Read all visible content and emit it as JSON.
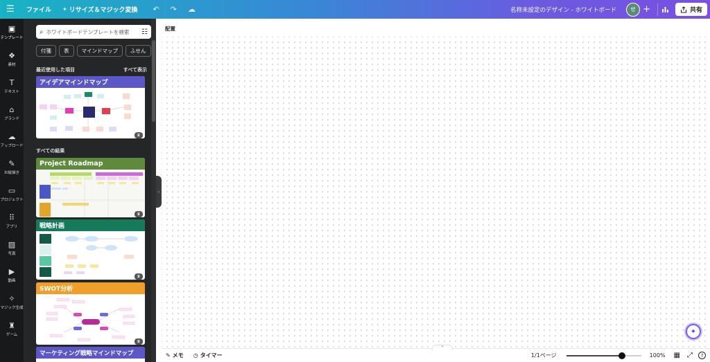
{
  "topbar": {
    "file": "ファイル",
    "resize": "リサイズ＆マジック変換",
    "title": "名称未設定のデザイン - ホワイトボード",
    "avatar_initial": "せ",
    "share": "共有"
  },
  "rail": [
    {
      "label": "テンプレート",
      "icon": "template-icon"
    },
    {
      "label": "素材",
      "icon": "elements-icon"
    },
    {
      "label": "テキスト",
      "icon": "text-icon"
    },
    {
      "label": "ブランド",
      "icon": "brand-icon"
    },
    {
      "label": "アップロード",
      "icon": "upload-icon"
    },
    {
      "label": "お絵描き",
      "icon": "draw-icon"
    },
    {
      "label": "プロジェクト",
      "icon": "folder-icon"
    },
    {
      "label": "アプリ",
      "icon": "apps-icon"
    },
    {
      "label": "写真",
      "icon": "photo-icon"
    },
    {
      "label": "動画",
      "icon": "video-icon"
    },
    {
      "label": "マジック生成",
      "icon": "magic-generate-icon"
    },
    {
      "label": "ゲーム",
      "icon": "game-icon"
    }
  ],
  "panel": {
    "search_placeholder": "ホワイトボードテンプレートを検索",
    "chips": [
      "付箋",
      "表",
      "マインドマップ",
      "ふせん"
    ],
    "recent_heading": "最近使用した項目",
    "see_all": "すべて表示",
    "all_results": "すべての結果",
    "cards": [
      {
        "title": "アイデアマインドマップ",
        "color": "#5b57c8"
      },
      {
        "title": "Project Roadmap",
        "color": "#5d8a3c"
      },
      {
        "title": "戦略計画",
        "color": "#157a5a"
      },
      {
        "title": "SWOT分析",
        "color": "#f0a02a"
      },
      {
        "title": "マーケティング戦略マインドマップ",
        "color": "#5b57c8"
      }
    ]
  },
  "canvas": {
    "label": "配置"
  },
  "bottombar": {
    "memo": "メモ",
    "timer": "タイマー",
    "pages": "1/1ページ",
    "zoom": "100%",
    "zoom_level": 0.74
  },
  "colors": {
    "rail_bg": "#18191b",
    "panel_bg": "#252627",
    "accent": "#7b5cf0"
  }
}
